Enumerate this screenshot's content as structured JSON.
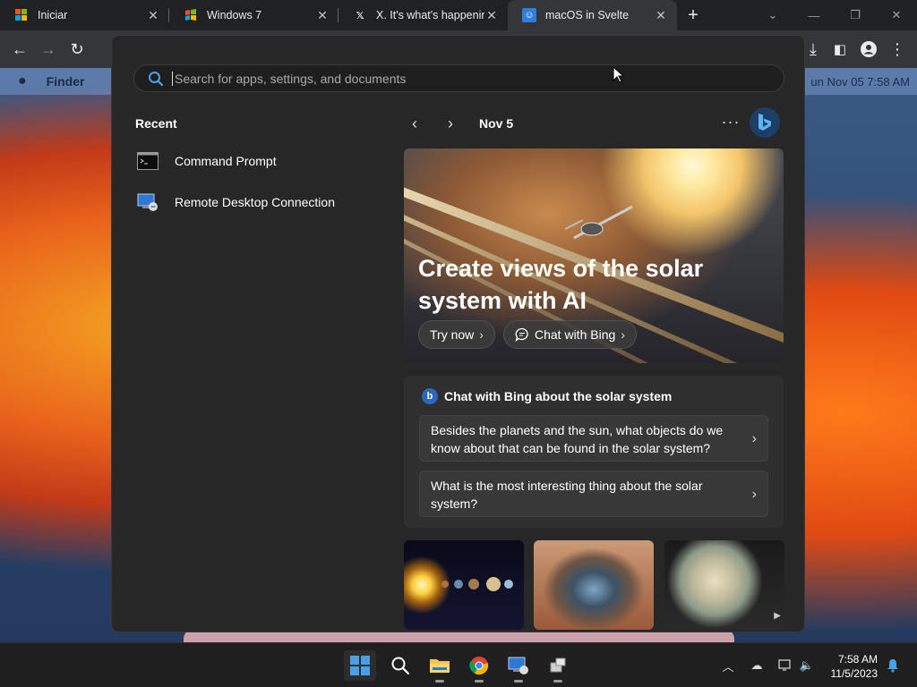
{
  "browser": {
    "tabs": [
      {
        "title": "Iniciar",
        "favicon": "windows-logo-icon"
      },
      {
        "title": "Windows 7",
        "favicon": "windows-flag-icon"
      },
      {
        "title": "X. It's what's happenin",
        "favicon": "x-logo-icon"
      },
      {
        "title": "macOS in Svelte",
        "favicon": "macos-icon"
      }
    ]
  },
  "mac": {
    "apple": "",
    "finder": "Finder",
    "clock": "un Nov 05   7:58 AM"
  },
  "start_menu": {
    "search_placeholder": "Search for apps, settings, and documents",
    "recent_title": "Recent",
    "recent_items": [
      {
        "label": "Command Prompt",
        "icon": "command-prompt-icon"
      },
      {
        "label": "Remote Desktop Connection",
        "icon": "remote-desktop-icon"
      }
    ],
    "date": "Nov 5",
    "more": "···",
    "hero": {
      "title": "Create views of the solar system with AI",
      "try_now": "Try now",
      "chat_with_bing": "Chat with Bing"
    },
    "chat_card": {
      "title": "Chat with Bing about the solar system",
      "questions": [
        "Besides the planets and the sun, what objects do we know about that can be found in the solar system?",
        "What is the most interesting thing about the solar system?"
      ]
    }
  },
  "taskbar": {
    "time": "7:58 AM",
    "date": "11/5/2023"
  },
  "colors": {
    "accent": "#4aa0e8",
    "menu_bg": "#272727",
    "taskbar_bg": "#1f1f1f"
  }
}
